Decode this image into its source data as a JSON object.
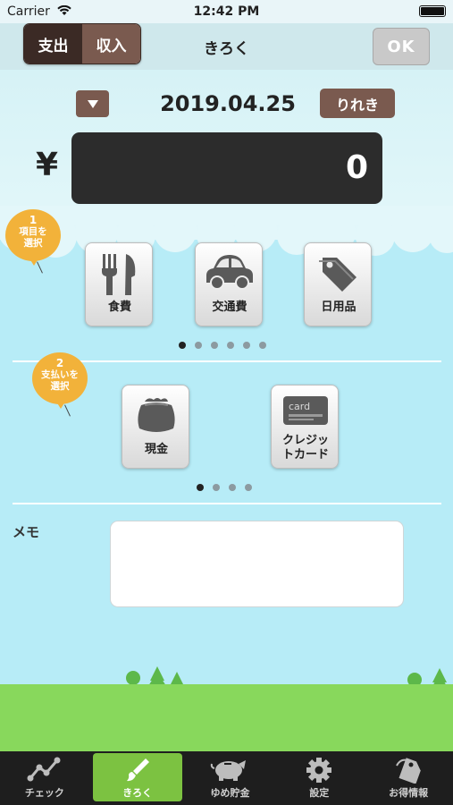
{
  "status_bar": {
    "carrier": "Carrier",
    "time": "12:42 PM"
  },
  "nav": {
    "title": "きろく",
    "segments": [
      {
        "label": "支出",
        "active": true
      },
      {
        "label": "収入",
        "active": false
      }
    ],
    "ok_label": "OK"
  },
  "date": {
    "value": "2019.04.25",
    "history_label": "りれき"
  },
  "amount": {
    "currency": "¥",
    "value": "0"
  },
  "step1": {
    "number": "1",
    "line1": "項目を",
    "line2": "選択"
  },
  "step2": {
    "number": "2",
    "line1": "支払いを",
    "line2": "選択"
  },
  "categories": [
    {
      "label": "食費",
      "icon": "fork-knife-icon"
    },
    {
      "label": "交通費",
      "icon": "car-icon"
    },
    {
      "label": "日用品",
      "icon": "price-tag-icon"
    }
  ],
  "category_pager": {
    "pages": 6,
    "current": 1
  },
  "payments": [
    {
      "label": "現金",
      "icon": "wallet-icon"
    },
    {
      "label_line1": "クレジッ",
      "label_line2": "トカード",
      "card_text": "card",
      "icon": "credit-card-icon"
    }
  ],
  "payment_pager": {
    "pages": 4,
    "current": 1
  },
  "memo": {
    "label": "メモ",
    "value": ""
  },
  "tabs": [
    {
      "label": "チェック",
      "icon": "chart-line-icon",
      "active": false
    },
    {
      "label": "きろく",
      "icon": "brush-icon",
      "active": true
    },
    {
      "label": "ゆめ貯金",
      "icon": "piggy-bank-icon",
      "active": false
    },
    {
      "label": "設定",
      "icon": "gear-icon",
      "active": false
    },
    {
      "label": "お得情報",
      "icon": "tag-icon",
      "active": false
    }
  ],
  "colors": {
    "brown_dark": "#3b2a25",
    "brown": "#7a5a4f",
    "sky": "#b7ecf7",
    "grass": "#88d85c",
    "badge": "#f2b23a",
    "tab_active": "#7cc241"
  }
}
